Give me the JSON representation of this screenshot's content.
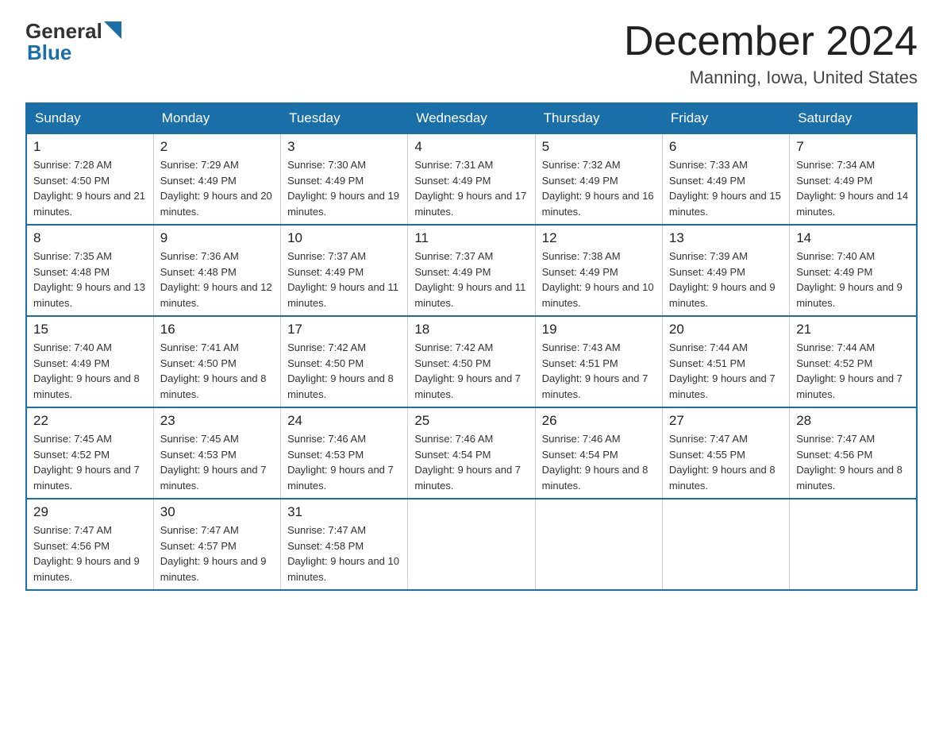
{
  "logo": {
    "text_general": "General",
    "text_blue": "Blue"
  },
  "header": {
    "month": "December 2024",
    "location": "Manning, Iowa, United States"
  },
  "days_of_week": [
    "Sunday",
    "Monday",
    "Tuesday",
    "Wednesday",
    "Thursday",
    "Friday",
    "Saturday"
  ],
  "weeks": [
    [
      {
        "day": "1",
        "sunrise": "7:28 AM",
        "sunset": "4:50 PM",
        "daylight": "9 hours and 21 minutes."
      },
      {
        "day": "2",
        "sunrise": "7:29 AM",
        "sunset": "4:49 PM",
        "daylight": "9 hours and 20 minutes."
      },
      {
        "day": "3",
        "sunrise": "7:30 AM",
        "sunset": "4:49 PM",
        "daylight": "9 hours and 19 minutes."
      },
      {
        "day": "4",
        "sunrise": "7:31 AM",
        "sunset": "4:49 PM",
        "daylight": "9 hours and 17 minutes."
      },
      {
        "day": "5",
        "sunrise": "7:32 AM",
        "sunset": "4:49 PM",
        "daylight": "9 hours and 16 minutes."
      },
      {
        "day": "6",
        "sunrise": "7:33 AM",
        "sunset": "4:49 PM",
        "daylight": "9 hours and 15 minutes."
      },
      {
        "day": "7",
        "sunrise": "7:34 AM",
        "sunset": "4:49 PM",
        "daylight": "9 hours and 14 minutes."
      }
    ],
    [
      {
        "day": "8",
        "sunrise": "7:35 AM",
        "sunset": "4:48 PM",
        "daylight": "9 hours and 13 minutes."
      },
      {
        "day": "9",
        "sunrise": "7:36 AM",
        "sunset": "4:48 PM",
        "daylight": "9 hours and 12 minutes."
      },
      {
        "day": "10",
        "sunrise": "7:37 AM",
        "sunset": "4:49 PM",
        "daylight": "9 hours and 11 minutes."
      },
      {
        "day": "11",
        "sunrise": "7:37 AM",
        "sunset": "4:49 PM",
        "daylight": "9 hours and 11 minutes."
      },
      {
        "day": "12",
        "sunrise": "7:38 AM",
        "sunset": "4:49 PM",
        "daylight": "9 hours and 10 minutes."
      },
      {
        "day": "13",
        "sunrise": "7:39 AM",
        "sunset": "4:49 PM",
        "daylight": "9 hours and 9 minutes."
      },
      {
        "day": "14",
        "sunrise": "7:40 AM",
        "sunset": "4:49 PM",
        "daylight": "9 hours and 9 minutes."
      }
    ],
    [
      {
        "day": "15",
        "sunrise": "7:40 AM",
        "sunset": "4:49 PM",
        "daylight": "9 hours and 8 minutes."
      },
      {
        "day": "16",
        "sunrise": "7:41 AM",
        "sunset": "4:50 PM",
        "daylight": "9 hours and 8 minutes."
      },
      {
        "day": "17",
        "sunrise": "7:42 AM",
        "sunset": "4:50 PM",
        "daylight": "9 hours and 8 minutes."
      },
      {
        "day": "18",
        "sunrise": "7:42 AM",
        "sunset": "4:50 PM",
        "daylight": "9 hours and 7 minutes."
      },
      {
        "day": "19",
        "sunrise": "7:43 AM",
        "sunset": "4:51 PM",
        "daylight": "9 hours and 7 minutes."
      },
      {
        "day": "20",
        "sunrise": "7:44 AM",
        "sunset": "4:51 PM",
        "daylight": "9 hours and 7 minutes."
      },
      {
        "day": "21",
        "sunrise": "7:44 AM",
        "sunset": "4:52 PM",
        "daylight": "9 hours and 7 minutes."
      }
    ],
    [
      {
        "day": "22",
        "sunrise": "7:45 AM",
        "sunset": "4:52 PM",
        "daylight": "9 hours and 7 minutes."
      },
      {
        "day": "23",
        "sunrise": "7:45 AM",
        "sunset": "4:53 PM",
        "daylight": "9 hours and 7 minutes."
      },
      {
        "day": "24",
        "sunrise": "7:46 AM",
        "sunset": "4:53 PM",
        "daylight": "9 hours and 7 minutes."
      },
      {
        "day": "25",
        "sunrise": "7:46 AM",
        "sunset": "4:54 PM",
        "daylight": "9 hours and 7 minutes."
      },
      {
        "day": "26",
        "sunrise": "7:46 AM",
        "sunset": "4:54 PM",
        "daylight": "9 hours and 8 minutes."
      },
      {
        "day": "27",
        "sunrise": "7:47 AM",
        "sunset": "4:55 PM",
        "daylight": "9 hours and 8 minutes."
      },
      {
        "day": "28",
        "sunrise": "7:47 AM",
        "sunset": "4:56 PM",
        "daylight": "9 hours and 8 minutes."
      }
    ],
    [
      {
        "day": "29",
        "sunrise": "7:47 AM",
        "sunset": "4:56 PM",
        "daylight": "9 hours and 9 minutes."
      },
      {
        "day": "30",
        "sunrise": "7:47 AM",
        "sunset": "4:57 PM",
        "daylight": "9 hours and 9 minutes."
      },
      {
        "day": "31",
        "sunrise": "7:47 AM",
        "sunset": "4:58 PM",
        "daylight": "9 hours and 10 minutes."
      },
      null,
      null,
      null,
      null
    ]
  ],
  "labels": {
    "sunrise": "Sunrise: ",
    "sunset": "Sunset: ",
    "daylight": "Daylight: "
  }
}
